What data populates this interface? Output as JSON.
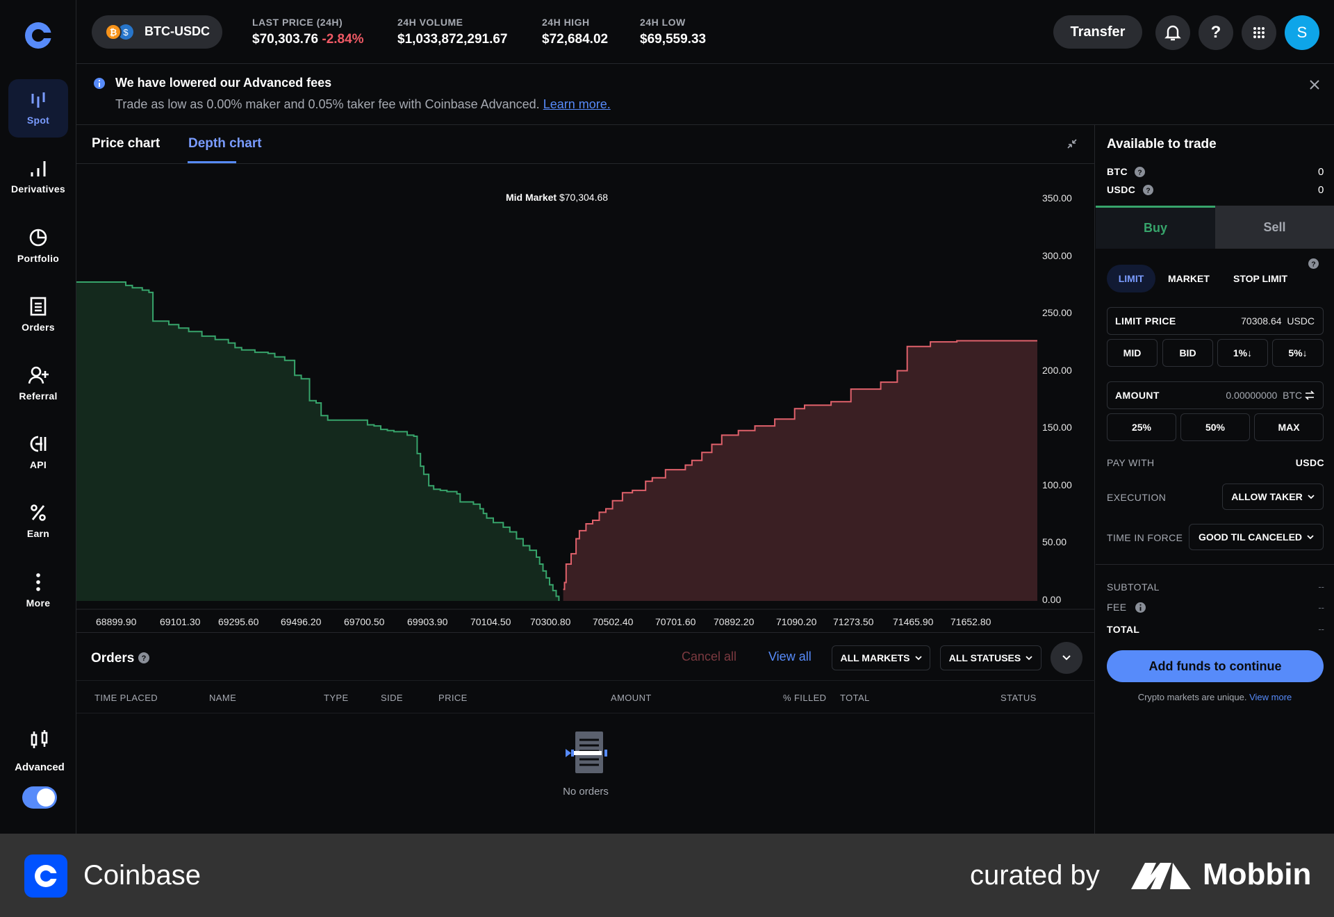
{
  "app": {
    "name": "Coinbase"
  },
  "sidebar": {
    "items": [
      {
        "label": "Spot",
        "icon": "spot-icon"
      },
      {
        "label": "Derivatives",
        "icon": "bar-chart-icon"
      },
      {
        "label": "Portfolio",
        "icon": "pie-chart-icon"
      },
      {
        "label": "Orders",
        "icon": "document-icon"
      },
      {
        "label": "Referral",
        "icon": "user-plus-icon"
      },
      {
        "label": "API",
        "icon": "api-icon"
      },
      {
        "label": "Earn",
        "icon": "percent-icon"
      },
      {
        "label": "More",
        "icon": "more-vertical-icon"
      }
    ],
    "advanced_label": "Advanced",
    "advanced_toggle": true
  },
  "topbar": {
    "pair": "BTC-USDC",
    "stats": [
      {
        "label": "LAST PRICE (24H)",
        "value": "$70,303.76",
        "change": "-2.84%"
      },
      {
        "label": "24H VOLUME",
        "value": "$1,033,872,291.67"
      },
      {
        "label": "24H HIGH",
        "value": "$72,684.02"
      },
      {
        "label": "24H LOW",
        "value": "$69,559.33"
      }
    ],
    "transfer_label": "Transfer",
    "avatar_letter": "S"
  },
  "banner": {
    "title": "We have lowered our Advanced fees",
    "body": "Trade as low as 0.00% maker and 0.05% taker fee with Coinbase Advanced.",
    "link": "Learn more."
  },
  "chart_tabs": [
    "Price chart",
    "Depth chart"
  ],
  "chart_data": {
    "type": "area",
    "annotation": {
      "label": "Mid Market",
      "value": "$70,304.68"
    },
    "x_tick_labels": [
      "68899.90",
      "69101.30",
      "69295.60",
      "69496.20",
      "69700.50",
      "69903.90",
      "70104.50",
      "70300.80",
      "70502.40",
      "70701.60",
      "70892.20",
      "71090.20",
      "71273.50",
      "71465.90",
      "71652.80"
    ],
    "y_tick_labels": [
      "350.00",
      "300.00",
      "250.00",
      "200.00",
      "150.00",
      "100.00",
      "50.00",
      "0.00"
    ],
    "ylim": [
      0,
      350
    ],
    "xlim": [
      68841,
      71743
    ],
    "series": [
      {
        "side": "bid",
        "color": "#37a46b",
        "fill": "#14291d",
        "x": [
          68841,
          68972,
          68990,
          69010,
          69040,
          69060,
          69072,
          69120,
          69150,
          69180,
          69220,
          69260,
          69300,
          69320,
          69340,
          69380,
          69420,
          69440,
          69470,
          69500,
          69520,
          69545,
          69565,
          69580,
          69600,
          69700,
          69720,
          69740,
          69760,
          69780,
          69800,
          69840,
          69860,
          69870,
          69880,
          69890,
          69905,
          69920,
          69940,
          69960,
          69990,
          70000,
          70040,
          70060,
          70070,
          70080,
          70100,
          70130,
          70150,
          70170,
          70190,
          70210,
          70230,
          70240,
          70250,
          70260,
          70270,
          70280,
          70290,
          70298
        ],
        "y": [
          277,
          277,
          274,
          272,
          270,
          268,
          243,
          240,
          237,
          234,
          230,
          227,
          224,
          220,
          218,
          216,
          215,
          212,
          209,
          196,
          193,
          174,
          172,
          161,
          157,
          157,
          153,
          152,
          149,
          148,
          147,
          144,
          143,
          128,
          117,
          110,
          100,
          97,
          96,
          95,
          93,
          86,
          84,
          80,
          76,
          72,
          68,
          64,
          60,
          54,
          48,
          44,
          38,
          32,
          26,
          20,
          14,
          9,
          4,
          0
        ]
      },
      {
        "side": "ask",
        "color": "#e0616b",
        "fill": "#3a1f23",
        "x": [
          70311,
          70315,
          70320,
          70335,
          70350,
          70360,
          70380,
          70400,
          70420,
          70440,
          70460,
          70490,
          70520,
          70560,
          70580,
          70620,
          70680,
          70700,
          70730,
          70760,
          70790,
          70840,
          70890,
          70950,
          71010,
          71040,
          71120,
          71180,
          71270,
          71320,
          71350,
          71420,
          71500,
          71743
        ],
        "y": [
          10,
          16,
          32,
          41,
          54,
          61,
          67,
          70,
          77,
          80,
          87,
          94,
          96,
          104,
          107,
          114,
          118,
          122,
          129,
          136,
          144,
          148,
          152,
          158,
          167,
          170,
          173,
          184,
          190,
          200,
          221,
          225,
          226,
          226
        ]
      }
    ]
  },
  "orders": {
    "title": "Orders",
    "cancel_all": "Cancel all",
    "view_all": "View all",
    "markets_filter": "ALL MARKETS",
    "status_filter": "ALL STATUSES",
    "columns": [
      "TIME PLACED",
      "NAME",
      "TYPE",
      "SIDE",
      "PRICE",
      "AMOUNT",
      "% FILLED",
      "TOTAL",
      "STATUS"
    ],
    "empty_text": "No orders"
  },
  "trade": {
    "available_title": "Available to trade",
    "balances": [
      {
        "asset": "BTC",
        "value": "0"
      },
      {
        "asset": "USDC",
        "value": "0"
      }
    ],
    "sides": [
      "Buy",
      "Sell"
    ],
    "order_types": [
      "LIMIT",
      "MARKET",
      "STOP LIMIT"
    ],
    "limit_price_label": "LIMIT PRICE",
    "limit_price_value": "70308.64",
    "limit_price_unit": "USDC",
    "price_presets": [
      "MID",
      "BID",
      "1%↓",
      "5%↓"
    ],
    "amount_label": "AMOUNT",
    "amount_value": "0.00000000",
    "amount_unit": "BTC",
    "amount_presets": [
      "25%",
      "50%",
      "MAX"
    ],
    "pay_with_label": "PAY WITH",
    "pay_with_value": "USDC",
    "execution_label": "EXECUTION",
    "execution_value": "ALLOW TAKER",
    "tif_label": "TIME IN FORCE",
    "tif_value": "GOOD TIL CANCELED",
    "subtotal_label": "SUBTOTAL",
    "subtotal_value": "--",
    "fee_label": "FEE",
    "fee_value": "--",
    "total_label": "TOTAL",
    "total_value": "--",
    "cta": "Add funds to continue",
    "note": "Crypto markets are unique.",
    "note_link": "View more"
  },
  "footer": {
    "brand": "Coinbase",
    "curated": "curated by",
    "curator": "Mobbin"
  },
  "colors": {
    "accent": "#578bfa",
    "buy": "#37a46b",
    "sell": "#e0616b",
    "brand": "#0052ff"
  }
}
